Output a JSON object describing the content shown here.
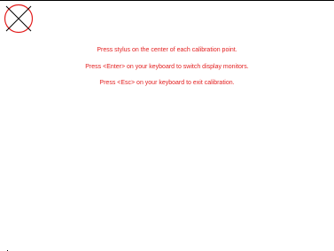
{
  "calibration": {
    "instructions": [
      "Press stylus on the center of each calibration point.",
      "Press <Enter> on your keyboard to switch display monitors.",
      "Press <Esc> on your keyboard to exit calibration."
    ]
  },
  "colors": {
    "instruction_text": "#e31e1e",
    "target_circle": "#e31e1e",
    "target_cross": "#000000",
    "background": "#ffffff"
  },
  "icons": {
    "target": "calibration-target-icon"
  }
}
